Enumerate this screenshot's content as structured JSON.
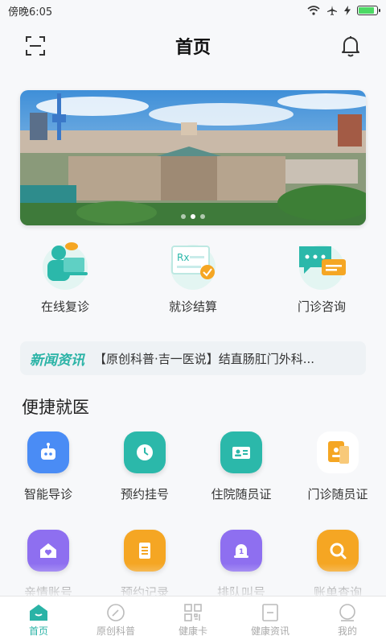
{
  "status": {
    "time": "傍晚6:05",
    "battery_level": 0.85
  },
  "header": {
    "title": "首页",
    "scan_icon": "scan-icon",
    "bell_icon": "bell-icon"
  },
  "banner": {
    "slide_count": 3,
    "active_index": 1
  },
  "services": [
    {
      "label": "在线复诊",
      "icon": "doctor-laptop-icon"
    },
    {
      "label": "就诊结算",
      "icon": "prescription-check-icon"
    },
    {
      "label": "门诊咨询",
      "icon": "chat-bubble-icon"
    }
  ],
  "news": {
    "tag": "新闻资讯",
    "text": "【原创科普·吉一医说】结直肠肛门外科..."
  },
  "quick": {
    "title": "便捷就医",
    "items": [
      {
        "label": "智能导诊",
        "icon": "robot-icon",
        "color": "#4a8cf5"
      },
      {
        "label": "预约挂号",
        "icon": "clock-icon",
        "color": "#2bb8aa"
      },
      {
        "label": "住院随员证",
        "icon": "id-card-icon",
        "color": "#2bb8aa"
      },
      {
        "label": "门诊随员证",
        "icon": "badge-icon",
        "color": "#f5a623"
      },
      {
        "label": "亲情账号",
        "icon": "home-heart-icon",
        "color": "#8e6ff0"
      },
      {
        "label": "预约记录",
        "icon": "document-icon",
        "color": "#f5a623"
      },
      {
        "label": "排队叫号",
        "icon": "queue-bell-icon",
        "color": "#8e6ff0"
      },
      {
        "label": "账单查询",
        "icon": "search-icon",
        "color": "#f5a623"
      }
    ]
  },
  "tabs": [
    {
      "label": "首页",
      "icon": "home-icon",
      "active": true
    },
    {
      "label": "原创科普",
      "icon": "compass-icon",
      "active": false
    },
    {
      "label": "健康卡",
      "icon": "qr-code-icon",
      "active": false
    },
    {
      "label": "健康资讯",
      "icon": "news-icon",
      "active": false
    },
    {
      "label": "我的",
      "icon": "user-icon",
      "active": false
    }
  ],
  "colors": {
    "accent": "#2ab3a6",
    "background": "#f7f8fa"
  }
}
